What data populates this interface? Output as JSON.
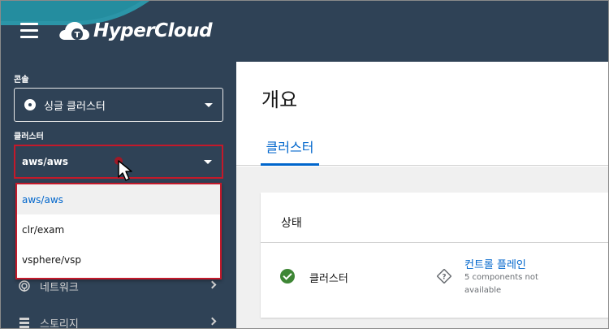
{
  "masthead": {
    "brand": "HyperCloud",
    "logo_letter": "T"
  },
  "sidebar": {
    "console_label": "콘솔",
    "console_value": "싱글 클러스터",
    "cluster_label": "클러스터",
    "cluster_value": "aws/aws",
    "cluster_options": [
      {
        "label": "aws/aws",
        "selected": true
      },
      {
        "label": "clr/exam",
        "selected": false
      },
      {
        "label": "vsphere/vsp",
        "selected": false
      }
    ],
    "nav_items": [
      {
        "label": "네트워크",
        "icon": "network-icon"
      },
      {
        "label": "스토리지",
        "icon": "storage-icon"
      }
    ]
  },
  "main": {
    "title": "개요",
    "tab": "클러스터",
    "card": {
      "title": "상태",
      "status_label": "클러스터",
      "control_plane_link": "컨트롤 플레인",
      "control_plane_sub": "5 components not available"
    }
  },
  "colors": {
    "masthead": "#2f4256",
    "accent_teal": "#2b95a8",
    "highlight_red": "#c4192a",
    "link_blue": "#0066cc",
    "ok_green": "#3e8635"
  }
}
